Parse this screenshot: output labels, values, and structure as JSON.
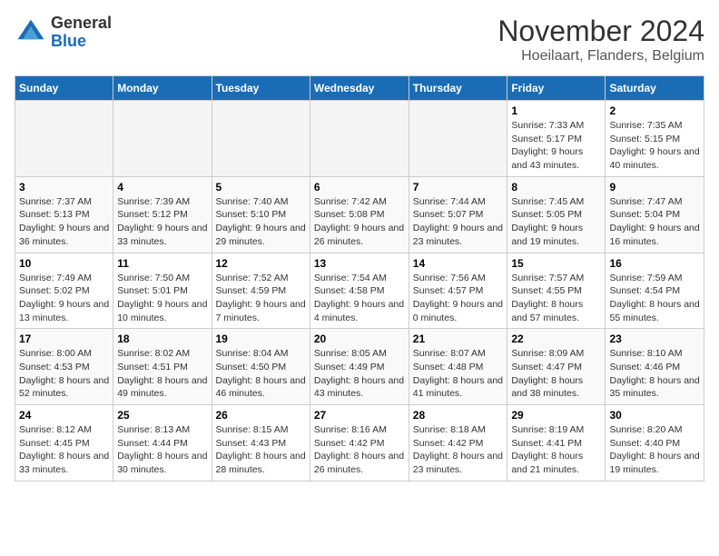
{
  "logo": {
    "general": "General",
    "blue": "Blue"
  },
  "title": "November 2024",
  "subtitle": "Hoeilaart, Flanders, Belgium",
  "days_header": [
    "Sunday",
    "Monday",
    "Tuesday",
    "Wednesday",
    "Thursday",
    "Friday",
    "Saturday"
  ],
  "weeks": [
    [
      {
        "day": "",
        "info": ""
      },
      {
        "day": "",
        "info": ""
      },
      {
        "day": "",
        "info": ""
      },
      {
        "day": "",
        "info": ""
      },
      {
        "day": "",
        "info": ""
      },
      {
        "day": "1",
        "info": "Sunrise: 7:33 AM\nSunset: 5:17 PM\nDaylight: 9 hours and 43 minutes."
      },
      {
        "day": "2",
        "info": "Sunrise: 7:35 AM\nSunset: 5:15 PM\nDaylight: 9 hours and 40 minutes."
      }
    ],
    [
      {
        "day": "3",
        "info": "Sunrise: 7:37 AM\nSunset: 5:13 PM\nDaylight: 9 hours and 36 minutes."
      },
      {
        "day": "4",
        "info": "Sunrise: 7:39 AM\nSunset: 5:12 PM\nDaylight: 9 hours and 33 minutes."
      },
      {
        "day": "5",
        "info": "Sunrise: 7:40 AM\nSunset: 5:10 PM\nDaylight: 9 hours and 29 minutes."
      },
      {
        "day": "6",
        "info": "Sunrise: 7:42 AM\nSunset: 5:08 PM\nDaylight: 9 hours and 26 minutes."
      },
      {
        "day": "7",
        "info": "Sunrise: 7:44 AM\nSunset: 5:07 PM\nDaylight: 9 hours and 23 minutes."
      },
      {
        "day": "8",
        "info": "Sunrise: 7:45 AM\nSunset: 5:05 PM\nDaylight: 9 hours and 19 minutes."
      },
      {
        "day": "9",
        "info": "Sunrise: 7:47 AM\nSunset: 5:04 PM\nDaylight: 9 hours and 16 minutes."
      }
    ],
    [
      {
        "day": "10",
        "info": "Sunrise: 7:49 AM\nSunset: 5:02 PM\nDaylight: 9 hours and 13 minutes."
      },
      {
        "day": "11",
        "info": "Sunrise: 7:50 AM\nSunset: 5:01 PM\nDaylight: 9 hours and 10 minutes."
      },
      {
        "day": "12",
        "info": "Sunrise: 7:52 AM\nSunset: 4:59 PM\nDaylight: 9 hours and 7 minutes."
      },
      {
        "day": "13",
        "info": "Sunrise: 7:54 AM\nSunset: 4:58 PM\nDaylight: 9 hours and 4 minutes."
      },
      {
        "day": "14",
        "info": "Sunrise: 7:56 AM\nSunset: 4:57 PM\nDaylight: 9 hours and 0 minutes."
      },
      {
        "day": "15",
        "info": "Sunrise: 7:57 AM\nSunset: 4:55 PM\nDaylight: 8 hours and 57 minutes."
      },
      {
        "day": "16",
        "info": "Sunrise: 7:59 AM\nSunset: 4:54 PM\nDaylight: 8 hours and 55 minutes."
      }
    ],
    [
      {
        "day": "17",
        "info": "Sunrise: 8:00 AM\nSunset: 4:53 PM\nDaylight: 8 hours and 52 minutes."
      },
      {
        "day": "18",
        "info": "Sunrise: 8:02 AM\nSunset: 4:51 PM\nDaylight: 8 hours and 49 minutes."
      },
      {
        "day": "19",
        "info": "Sunrise: 8:04 AM\nSunset: 4:50 PM\nDaylight: 8 hours and 46 minutes."
      },
      {
        "day": "20",
        "info": "Sunrise: 8:05 AM\nSunset: 4:49 PM\nDaylight: 8 hours and 43 minutes."
      },
      {
        "day": "21",
        "info": "Sunrise: 8:07 AM\nSunset: 4:48 PM\nDaylight: 8 hours and 41 minutes."
      },
      {
        "day": "22",
        "info": "Sunrise: 8:09 AM\nSunset: 4:47 PM\nDaylight: 8 hours and 38 minutes."
      },
      {
        "day": "23",
        "info": "Sunrise: 8:10 AM\nSunset: 4:46 PM\nDaylight: 8 hours and 35 minutes."
      }
    ],
    [
      {
        "day": "24",
        "info": "Sunrise: 8:12 AM\nSunset: 4:45 PM\nDaylight: 8 hours and 33 minutes."
      },
      {
        "day": "25",
        "info": "Sunrise: 8:13 AM\nSunset: 4:44 PM\nDaylight: 8 hours and 30 minutes."
      },
      {
        "day": "26",
        "info": "Sunrise: 8:15 AM\nSunset: 4:43 PM\nDaylight: 8 hours and 28 minutes."
      },
      {
        "day": "27",
        "info": "Sunrise: 8:16 AM\nSunset: 4:42 PM\nDaylight: 8 hours and 26 minutes."
      },
      {
        "day": "28",
        "info": "Sunrise: 8:18 AM\nSunset: 4:42 PM\nDaylight: 8 hours and 23 minutes."
      },
      {
        "day": "29",
        "info": "Sunrise: 8:19 AM\nSunset: 4:41 PM\nDaylight: 8 hours and 21 minutes."
      },
      {
        "day": "30",
        "info": "Sunrise: 8:20 AM\nSunset: 4:40 PM\nDaylight: 8 hours and 19 minutes."
      }
    ]
  ]
}
